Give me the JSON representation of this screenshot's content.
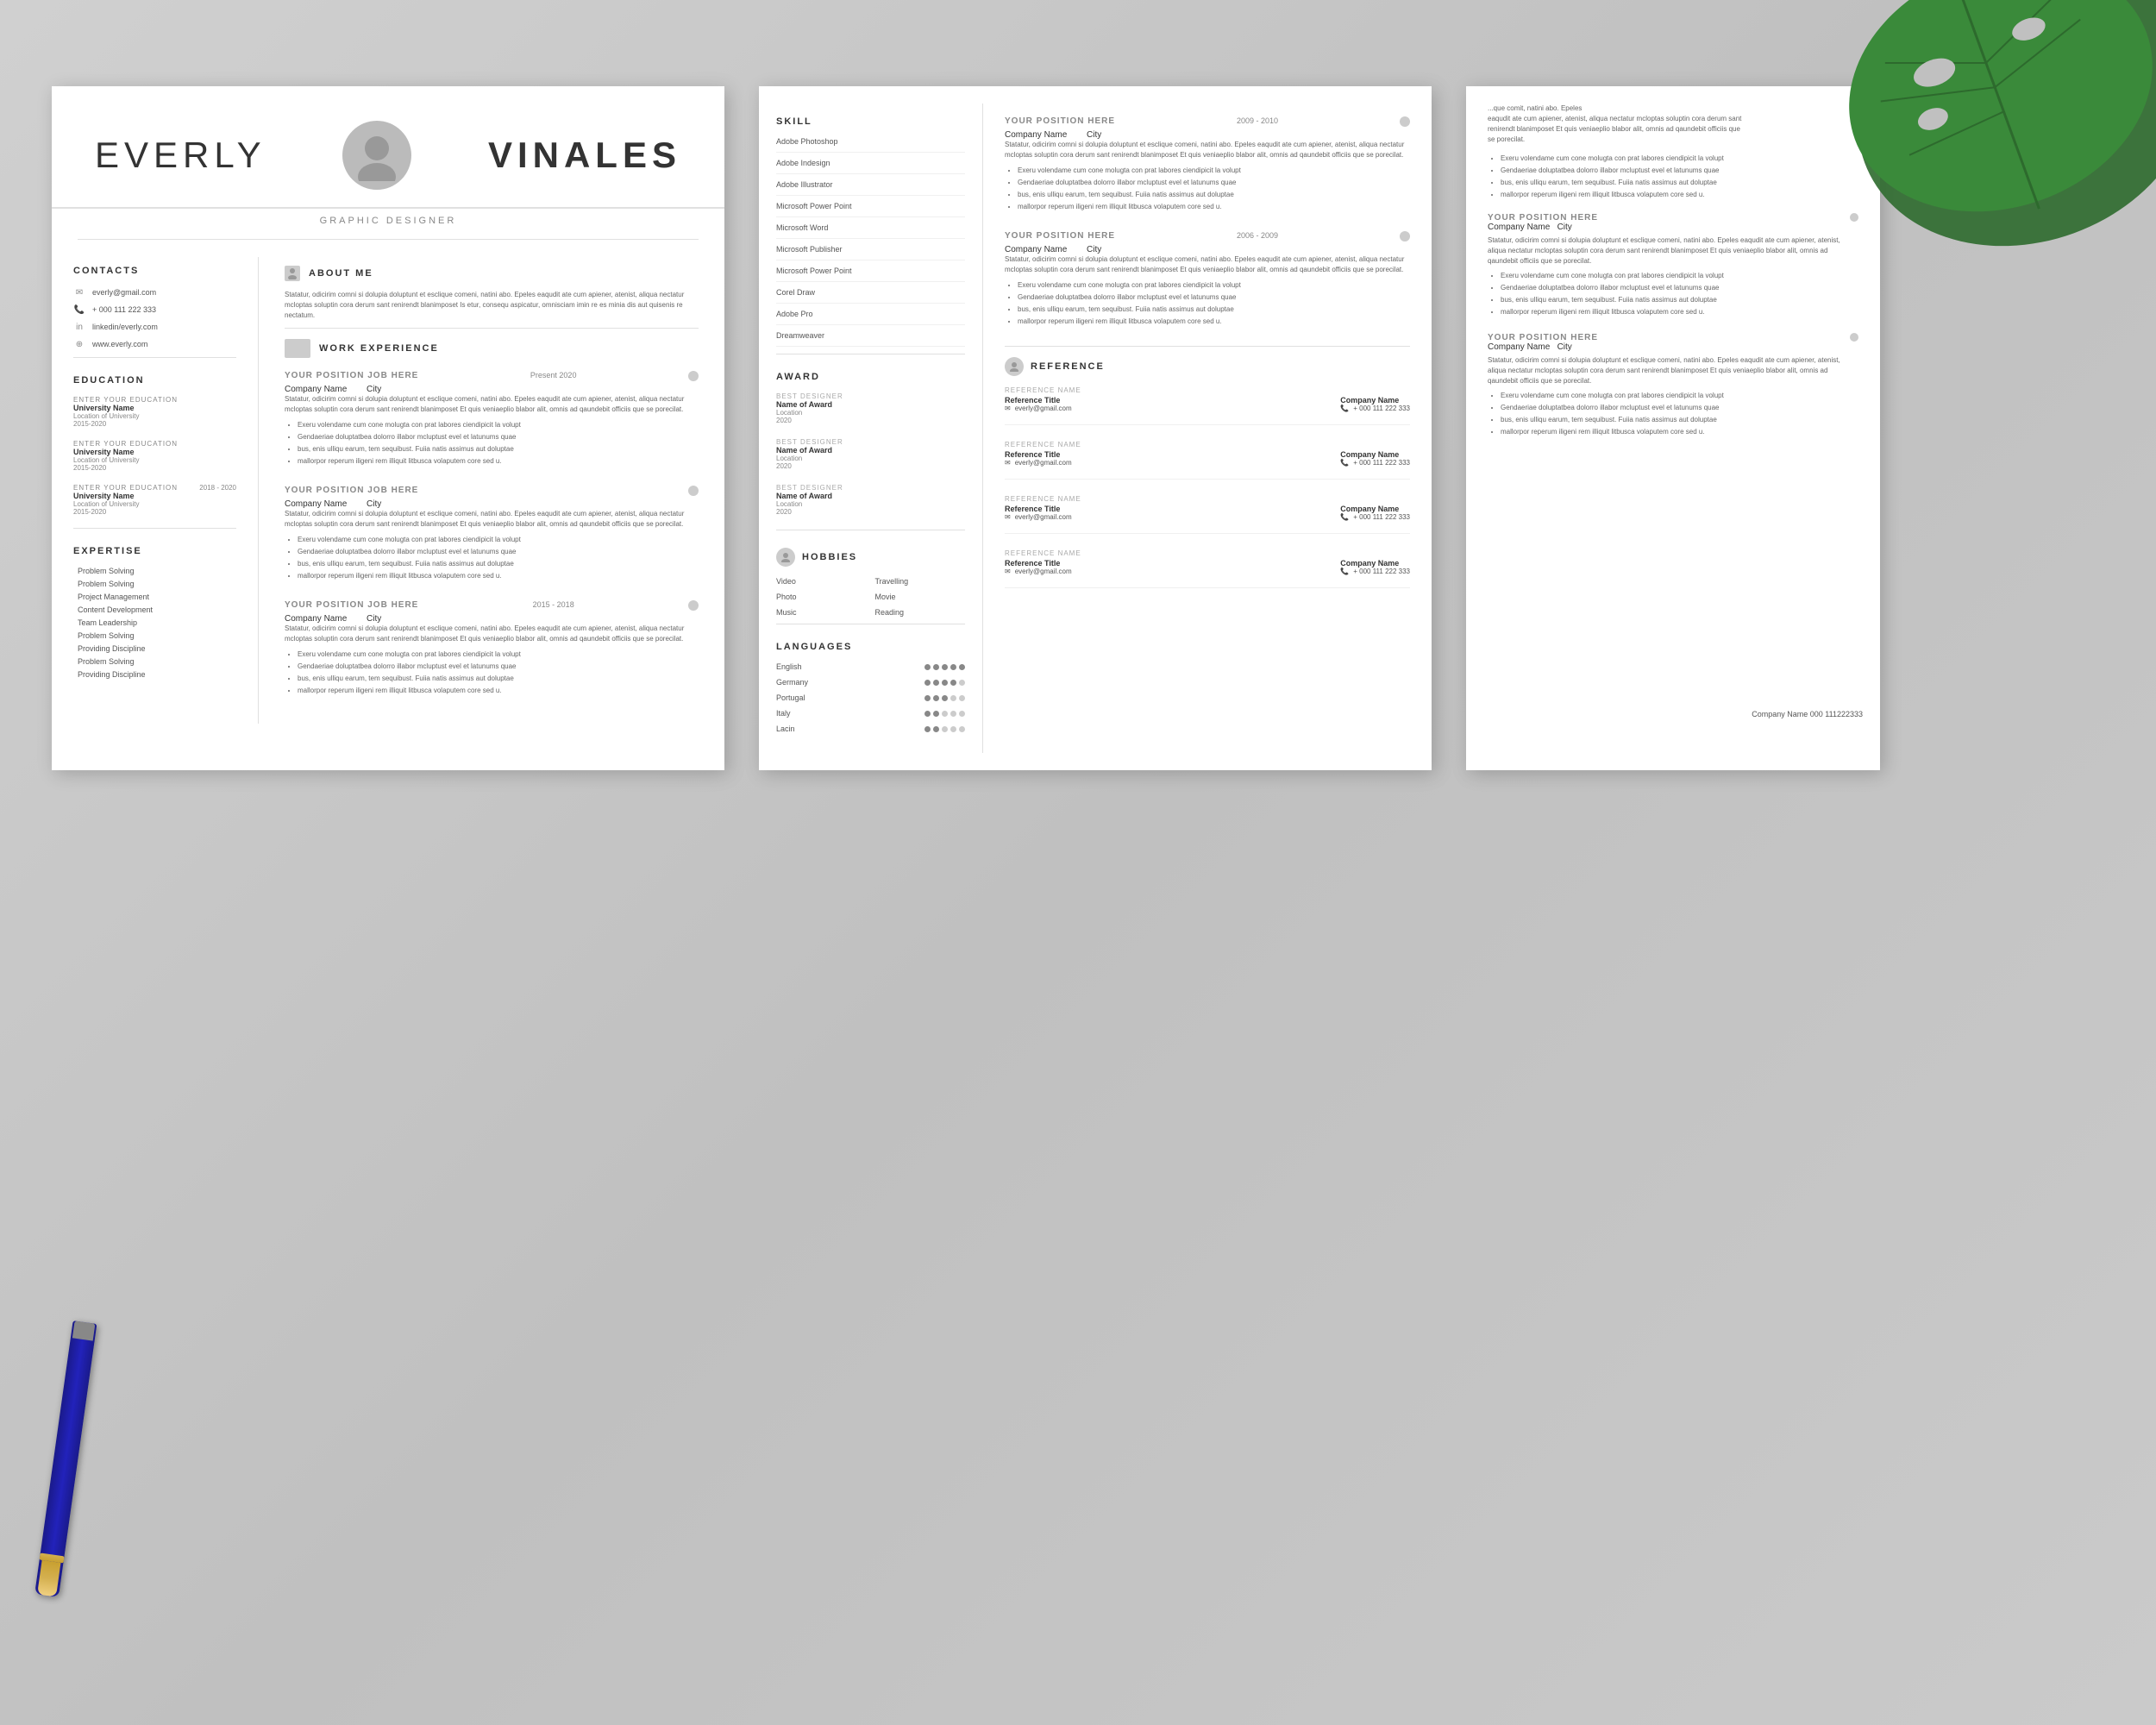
{
  "background": {
    "color": "#c8c8c8"
  },
  "page1": {
    "header": {
      "first_name": "EVERLY",
      "last_name": "VINALES",
      "title": "GRAPHIC DESIGNER"
    },
    "contacts": {
      "section_title": "CONTACTS",
      "email": "everly@gmail.com",
      "phone": "+ 000 111 222 333",
      "linkedin": "linkedin/everly.com",
      "website": "www.everly.com"
    },
    "education": {
      "section_title": "EDUCATION",
      "entries": [
        {
          "label": "ENTER YOUR EDUCATION",
          "university": "University Name",
          "location": "Location of University",
          "dates": "2015-2020",
          "date_right": ""
        },
        {
          "label": "ENTER YOUR EDUCATION",
          "university": "University Name",
          "location": "Location of University",
          "dates": "2015-2020",
          "date_right": ""
        },
        {
          "label": "ENTER YOUR EDUCATION",
          "university": "University Name",
          "location": "Location of University",
          "dates": "2015-2020",
          "date_right": "2018 - 2020"
        }
      ]
    },
    "expertise": {
      "section_title": "EXPERTISE",
      "items": [
        "Problem Solving",
        "Problem Solving",
        "Project Management",
        "Content Development",
        "Team Leadership",
        "Problem Solving",
        "Providing Discipline",
        "Problem Solving",
        "Providing Discipline"
      ]
    },
    "about_me": {
      "section_title": "ABOUT ME",
      "text": "Statatur, odicirim comni si dolupia doluptunt et esclique comeni, natini abo. Epeles eaqudit ate cum apiener, atenist, aliqua nectatur mcloptas soluptin cora derum sant renirendt blanimposet Is etur, consequ aspicatur, omnisciam imin re es minia dis aut quisenis re nectatum."
    },
    "work_experience": {
      "section_title": "WORK EXPERIENCE",
      "entries": [
        {
          "date_right": "Present 2020",
          "position": "YOUR POSITION JOB HERE",
          "company": "Company Name",
          "city": "City",
          "description": "Statatur, odicirim comni si dokupia doluptunt et esclique comeni, natini abo. Epeles eaqudit ate cum apiener, atenist, aliqua nectatur mcloptas soluptin cora derum sant renirendt blanimposet Et quis veniaeplio blabor alit, omnis ad qaundebit officiis que se porecilat.",
          "bullets": [
            "Exeru volendame cum cone molugta con prat labores ciendipicit la volupt",
            "Gendaeriae doluptatbea dolorro illabor mcluptust evel et latunums quae",
            "bus, enis ulliqu earum, tem sequibust. Fuiia natis assimus aut doluptae",
            "mallorpor reperum iligeni rem illiquit litbusca volaputem core sed u."
          ]
        },
        {
          "date_right": "",
          "position": "YOUR POSITION JOB HERE",
          "company": "Company Name",
          "city": "City",
          "description": "Statatur, odicirim comni si dolupia doluptunt et esclique comeni, natini abo. Epeles eaqudit ate cum apiener, atenist, aliqua nectatur mcloptas soluptin cora derum sant renirendt blanimposet Et quis veniaeplio blabor alit, omnis ad qaundebit officiis que se porecilat.",
          "bullets": [
            "Exeru volendame cum cone molugta con prat labores ciendipicit la volupt",
            "Gendaeriae doluptatbea dolorro illabor mcluptust evel et latunums quae",
            "bus, enis ulliqu earum, tem sequibust. Fuiia natis assimus aut doluptae",
            "mallorpor reperum iligeni rem illiquit litbusca volaputem core sed u."
          ]
        },
        {
          "date_right": "2015 - 2018",
          "position": "YOUR POSITION JOB HERE",
          "company": "Company Name",
          "city": "City",
          "description": "Statatur, odicirim comni si dolupia doluptunt et esclique comeni, natini abo. Epeles eaqudit ate cum apiener, atenist, aliqua nectatur mcloptas soluptin cora derum sant renirendt blanimposet Et quis veniaeplio blabor alit, omnis ad qaundebit officiis que se porecilat.",
          "bullets": [
            "Exeru volendame cum cone molugta con prat labores ciendipicit la volupt",
            "Gendaeriae doluptatbea dolorro illabor mcluptust evel et latunums quae",
            "bus, enis ulliqu earum, tem sequibust. Fuiia natis assimus aut doluptae",
            "mallorpor reperum iligeni rem illiquit litbusca volaputem core sed u."
          ]
        }
      ]
    }
  },
  "page2": {
    "skills": {
      "section_title": "SKILL",
      "items": [
        "Adobe Photoshop",
        "Adobe Indesign",
        "Adobe Illustrator",
        "Microsoft Power Point",
        "Microsoft Word",
        "Microsoft Publisher",
        "Microsoft Power Point",
        "Corel Draw",
        "Adobe Pro",
        "Dreamweaver"
      ]
    },
    "awards": {
      "section_title": "AWARD",
      "entries": [
        {
          "label": "BEST DESIGNER",
          "name": "Name of Award",
          "location": "Location",
          "year": "2020"
        },
        {
          "label": "BEST DESIGNER",
          "name": "Name of Award",
          "location": "Location",
          "year": "2020"
        },
        {
          "label": "BEST DESIGNER",
          "name": "Name of Award",
          "location": "Location",
          "year": "2020"
        }
      ]
    },
    "hobbies": {
      "section_title": "HOBBIES",
      "items": [
        {
          "left": "Video",
          "right": "Travelling"
        },
        {
          "left": "Photo",
          "right": "Movie"
        },
        {
          "left": "Music",
          "right": "Reading"
        }
      ]
    },
    "languages": {
      "section_title": "LANGUAGES",
      "items": [
        {
          "name": "English",
          "level": 5
        },
        {
          "name": "Germany",
          "level": 4
        },
        {
          "name": "Portugal",
          "level": 3
        },
        {
          "name": "Italy",
          "level": 2
        },
        {
          "name": "Lacin",
          "level": 2
        }
      ]
    },
    "work_experience": {
      "entries": [
        {
          "dates": "2009 - 2010",
          "position": "YOUR POSITION HERE",
          "company": "Company Name",
          "city": "City",
          "description": "Statatur, odicirim comni si dolupia doluptunt et esclique comeni, natini abo. Epeles eaqudit ate cum apiener, atenist, aliqua nectatur mcloptas soluptin cora derum sant renirendt blanimposet Et quis veniaeplio blabor alit, omnis ad qaundebit officiis que se porecilat.",
          "bullets": [
            "Exeru volendame cum cone molugta con prat labores ciendipicit la volupt",
            "Gendaeriae doluptatbea dolorro illabor mcluptust evel et latunums quae",
            "bus, enis ulliqu earum, tem sequibust. Fuiia natis assimus aut doluptae",
            "mallorpor reperum iligeni rem illiquit litbusca volaputem core sed u."
          ]
        },
        {
          "dates": "2006 - 2009",
          "position": "YOUR POSITION HERE",
          "company": "Company Name",
          "city": "City",
          "description": "Statatur, odicirim comni si dolupia doluptunt et esclique comeni, natini abo. Epeles eaqudit ate cum apiener, atenist, aliqua nectatur mcloptas soluptin cora derum sant renirendt blanimposet Et quis veniaeplio blabor alit, omnis ad qaundebit officiis que se porecilat.",
          "bullets": [
            "Exeru volendame cum cone molugta con prat labores ciendipicit la volupt",
            "Gendaeriae doluptatbea dolorro illabor mcluptust evel et latunums quae",
            "bus, enis ulliqu earum, tem sequibust. Fuiia natis assimus aut doluptae",
            "mallorpor reperum iligeni rem illiquit litbusca volaputem core sed u."
          ]
        }
      ]
    },
    "references": {
      "section_title": "REFERENCE",
      "entries": [
        {
          "label": "REFERENCE NAME",
          "title": "Reference Title",
          "company": "Company Name",
          "email": "everly@gmail.com",
          "phone": "+ 000 111 222 333"
        },
        {
          "label": "REFERENCE NAME",
          "title": "Reference Title",
          "company": "Company Name",
          "email": "everly@gmail.com",
          "phone": "+ 000 111 222 333"
        },
        {
          "label": "REFERENCE NAME",
          "title": "Reference Title",
          "company": "Company Name",
          "email": "everly@gmail.com",
          "phone": "+ 000 111 222 333"
        },
        {
          "label": "REFERENCE NAME",
          "title": "Reference Title",
          "company": "Company Name",
          "email": "everly@gmail.com",
          "phone": "+ 000 111 222 333"
        }
      ]
    }
  },
  "page3": {
    "work_entries": [
      {
        "dates": "",
        "position": "YOUR POSITION HERE",
        "company": "Company Name   City",
        "description": "Statatur, odicirim comni si dolupia doluptunt et esclique comeni, natini abo. Epeles eaqudit ate cum apiener, atenist, aliqua nectatur mcloptas soluptin cora derum sant renirendt blanimposet Et quis veniaeplio blabor alit, omnis ad qaundebit officiis que se porecilat.",
        "bullets": [
          "Exeru volendame cum cone molugta con prat labores ciendipicit la volupt",
          "Gendaeriae doluptatbea dolorro illabor mcluptust evel et latunums quae",
          "bus, enis ulliqu earum, tem sequibust. Fuiia natis assimus aut doluptae",
          "mallorpor reperum iligeni rem illiquit litbusca volaputem core sed u."
        ]
      },
      {
        "dates": "",
        "position": "YOUR POSITION HERE",
        "company": "Company Name   City",
        "description": "Statatur, odicirim comni si dolupia doluptunt et esclique comeni, natini abo. Epeles eaqudit ate cum apiener, atenist, aliqua nectatur mcloptas soluptin cora derum sant renirendt blanimposet Et quis veniaeplio blabor alit, omnis ad qaundebit officiis que se porecilat.",
        "bullets": [
          "Exeru volendame cum cone molugta con prat labores ciendipicit la volupt",
          "Gendaeriae doluptatbea dolorro illabor mcluptust evel et latunums quae",
          "bus, enis ulliqu earum, tem sequibust. Fuiia natis assimus aut doluptae",
          "mallorpor reperum iligeni rem illiquit litbusca volaputem core sed u."
        ]
      }
    ],
    "company_name": "Company Name 000 111222333"
  }
}
